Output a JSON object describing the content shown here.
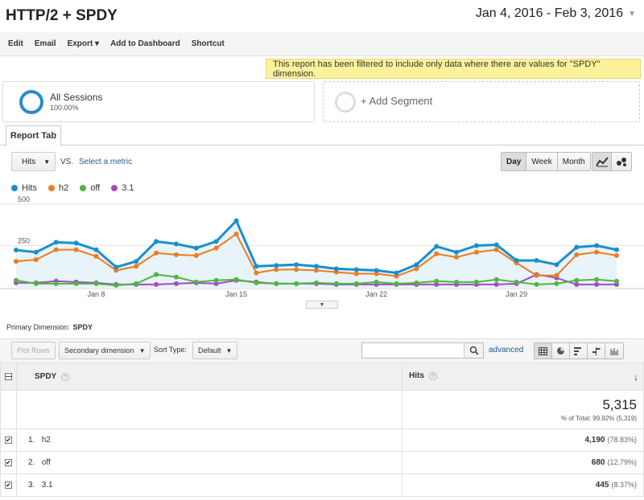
{
  "header": {
    "title": "HTTP/2 + SPDY",
    "date_range": "Jan 4, 2016 - Feb 3, 2016"
  },
  "toolbar": {
    "edit": "Edit",
    "email": "Email",
    "export": "Export",
    "add_dashboard": "Add to Dashboard",
    "shortcut": "Shortcut"
  },
  "notice": "This report has been filtered to include only data where there are values for \"SPDY\" dimension.",
  "segments": {
    "active_name": "All Sessions",
    "active_pct": "100.00%",
    "add_label": "+ Add Segment"
  },
  "report_tab": "Report Tab",
  "controls": {
    "metric": "Hits",
    "vs": "VS.",
    "select_metric": "Select a metric",
    "day": "Day",
    "week": "Week",
    "month": "Month"
  },
  "colors": {
    "hits": "#1a8fcc",
    "h2": "#ea7d21",
    "off": "#4fb63c",
    "v31": "#a24bc4"
  },
  "chart_data": {
    "type": "line",
    "x": [
      "Jan 4",
      "Jan 5",
      "Jan 6",
      "Jan 7",
      "Jan 8",
      "Jan 9",
      "Jan 10",
      "Jan 11",
      "Jan 12",
      "Jan 13",
      "Jan 14",
      "Jan 15",
      "Jan 16",
      "Jan 17",
      "Jan 18",
      "Jan 19",
      "Jan 20",
      "Jan 21",
      "Jan 22",
      "Jan 23",
      "Jan 24",
      "Jan 25",
      "Jan 26",
      "Jan 27",
      "Jan 28",
      "Jan 29",
      "Jan 30",
      "Jan 31",
      "Feb 1",
      "Feb 2",
      "Feb 3"
    ],
    "tick_labels": [
      "Jan 8",
      "Jan 15",
      "Jan 22",
      "Jan 29"
    ],
    "y_ticks": [
      "500",
      "250"
    ],
    "ylim": [
      0,
      500
    ],
    "series": [
      {
        "name": "Hits",
        "values": [
          223,
          210,
          270,
          265,
          225,
          120,
          155,
          275,
          260,
          235,
          275,
          400,
          125,
          130,
          135,
          125,
          110,
          105,
          100,
          85,
          135,
          245,
          210,
          250,
          255,
          160,
          160,
          135,
          240,
          250,
          225
        ]
      },
      {
        "name": "h2",
        "values": [
          155,
          165,
          225,
          225,
          185,
          100,
          125,
          205,
          195,
          190,
          235,
          320,
          85,
          105,
          105,
          100,
          90,
          80,
          80,
          65,
          110,
          200,
          180,
          210,
          225,
          145,
          70,
          70,
          195,
          210,
          190
        ]
      },
      {
        "name": "off",
        "values": [
          40,
          20,
          20,
          20,
          20,
          10,
          20,
          75,
          60,
          30,
          40,
          45,
          25,
          20,
          20,
          25,
          20,
          20,
          30,
          20,
          25,
          35,
          30,
          30,
          45,
          30,
          15,
          20,
          40,
          45,
          35
        ]
      },
      {
        "name": "3.1",
        "values": [
          25,
          25,
          35,
          30,
          25,
          15,
          15,
          15,
          20,
          25,
          20,
          40,
          30,
          20,
          20,
          20,
          15,
          15,
          15,
          15,
          15,
          15,
          15,
          15,
          15,
          20,
          75,
          55,
          15,
          15,
          15
        ]
      }
    ]
  },
  "table": {
    "primary_dimension_label": "Primary Dimension:",
    "primary_dimension": "SPDY",
    "plot_rows": "Plot Rows",
    "secondary_dimension": "Secondary dimension",
    "sort_type_label": "Sort Type:",
    "sort_type": "Default",
    "advanced": "advanced",
    "col_dimension": "SPDY",
    "col_metric": "Hits",
    "total": "5,315",
    "total_sub": "% of Total: 99.92% (5,319)",
    "rows": [
      {
        "index": "1.",
        "label": "h2",
        "value": "4,190",
        "pct": "(78.83%)"
      },
      {
        "index": "2.",
        "label": "off",
        "value": "680",
        "pct": "(12.79%)"
      },
      {
        "index": "3.",
        "label": "3.1",
        "value": "445",
        "pct": "(8.37%)"
      }
    ]
  }
}
